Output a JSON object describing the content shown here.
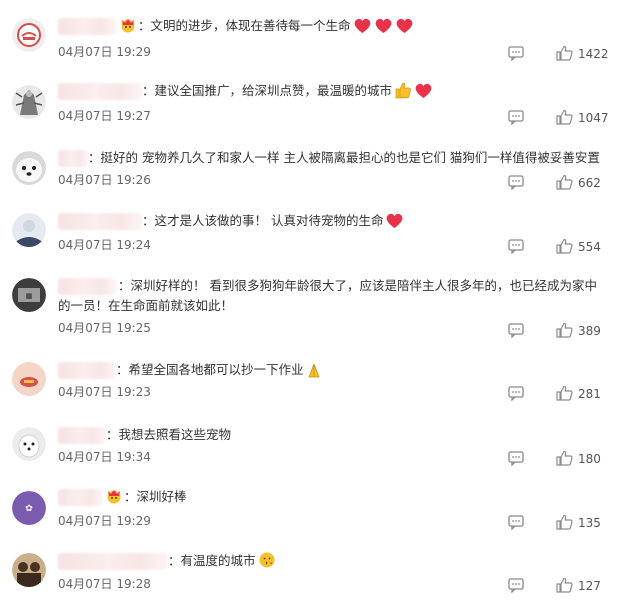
{
  "comments": [
    {
      "text": "：文明的进步，体现在善待每一个生命",
      "date": "04月07日 19:29",
      "likes": "1422",
      "reactions": [
        "heart",
        "heart",
        "heart"
      ],
      "badge": "crown-face"
    },
    {
      "text": "：建议全国推广，给深圳点赞，最温暖的城市",
      "date": "04月07日 19:27",
      "likes": "1047",
      "reactions": [
        "thumbs-up",
        "heart"
      ]
    },
    {
      "text": "：挺好的 宠物养几久了和家人一样 主人被隔离最担心的也是它们 猫狗们一样值得被妥善安置",
      "date": "04月07日 19:26",
      "likes": "662"
    },
    {
      "text": "：这才是人该做的事！ 认真对待宠物的生命",
      "date": "04月07日 19:24",
      "likes": "554",
      "reactions": [
        "heart"
      ]
    },
    {
      "text": "：深圳好样的！ 看到很多狗狗年龄很大了，应该是陪伴主人很多年的，也已经成为家中的一员！在生命面前就该如此！",
      "date": "04月07日 19:25",
      "likes": "389"
    },
    {
      "text": "：希望全国各地都可以抄一下作业",
      "date": "04月07日 19:23",
      "likes": "281",
      "reactions": [
        "pray"
      ]
    },
    {
      "text": "：我想去照看这些宠物",
      "date": "04月07日 19:34",
      "likes": "180"
    },
    {
      "text": "：深圳好棒",
      "date": "04月07日 19:29",
      "likes": "135",
      "badge": "crown-face"
    },
    {
      "text": "：有温度的城市",
      "date": "04月07日 19:28",
      "likes": "127",
      "reactions": [
        "kiss-face"
      ]
    }
  ],
  "colors": {
    "heart": "#e8324a",
    "text": "#333333",
    "meta": "#666666",
    "icon": "#8a8a8a"
  },
  "icons": {
    "reply": "comment-icon",
    "like": "thumbs-up-icon"
  }
}
